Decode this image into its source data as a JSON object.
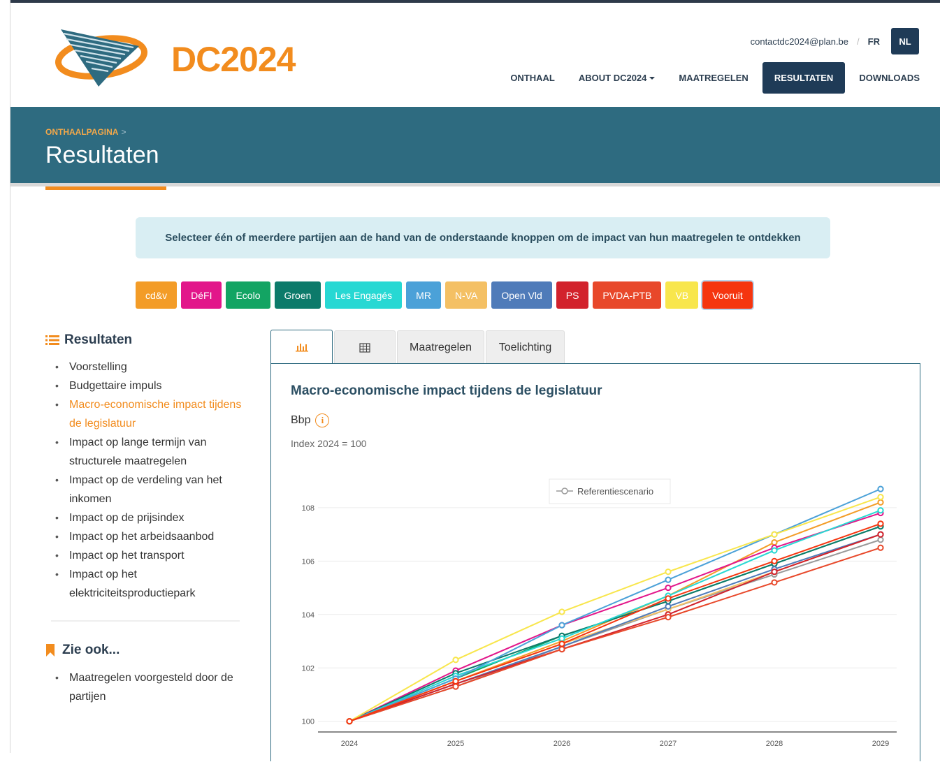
{
  "header": {
    "logo_text": "DC2024",
    "contact": "contactdc2024@plan.be",
    "lang_separator": "/",
    "lang_fr": "FR",
    "lang_nl": "NL",
    "nav": [
      {
        "label": "ONTHAAL"
      },
      {
        "label": "ABOUT DC2024"
      },
      {
        "label": "MAATREGELEN"
      },
      {
        "label": "RESULTATEN"
      },
      {
        "label": "DOWNLOADS"
      }
    ]
  },
  "banner": {
    "breadcrumb": "ONTHAALPAGINA",
    "breadcrumb_sep": ">",
    "title": "Resultaten"
  },
  "info_text": "Selecteer één of meerdere partijen aan de hand van de onderstaande knoppen om de impact van hun maatregelen te ontdekken",
  "parties": [
    {
      "label": "cd&v",
      "color": "#f39c27"
    },
    {
      "label": "DéFI",
      "color": "#e2168a"
    },
    {
      "label": "Ecolo",
      "color": "#13a463"
    },
    {
      "label": "Groen",
      "color": "#0c7a6a"
    },
    {
      "label": "Les Engagés",
      "color": "#27d8d3"
    },
    {
      "label": "MR",
      "color": "#4ba1d8"
    },
    {
      "label": "N-VA",
      "color": "#f4c064"
    },
    {
      "label": "Open Vld",
      "color": "#4f7bb9"
    },
    {
      "label": "PS",
      "color": "#d2222c"
    },
    {
      "label": "PVDA-PTB",
      "color": "#e8482a"
    },
    {
      "label": "VB",
      "color": "#f8e64c"
    },
    {
      "label": "Vooruit",
      "color": "#f5350f"
    }
  ],
  "sidebar": {
    "title": "Resultaten",
    "items": [
      {
        "label": "Voorstelling"
      },
      {
        "label": "Budgettaire impuls"
      },
      {
        "label": "Macro-economische impact tijdens de legislatuur"
      },
      {
        "label": "Impact op lange termijn van structurele maatregelen"
      },
      {
        "label": "Impact op de verdeling van het inkomen"
      },
      {
        "label": "Impact op de prijsindex"
      },
      {
        "label": "Impact op het arbeidsaanbod"
      },
      {
        "label": "Impact op het transport"
      },
      {
        "label": "Impact op het elektriciteitsproductiepark"
      }
    ],
    "active_index": 2,
    "see_also_title": "Zie ook...",
    "see_also_items": [
      {
        "label": "Maatregelen voorgesteld door de partijen"
      }
    ]
  },
  "tabs": {
    "chart_icon": "bar-chart-icon",
    "table_icon": "table-icon",
    "maatregelen": "Maatregelen",
    "toelichting": "Toelichting"
  },
  "panel": {
    "title": "Macro-economische impact tijdens de legislatuur",
    "variable": "Bbp",
    "info_glyph": "i",
    "subtitle": "Index 2024 = 100"
  },
  "chart_data": {
    "type": "line",
    "x": [
      "2024",
      "2025",
      "2026",
      "2027",
      "2028",
      "2029"
    ],
    "ylim": [
      99.6,
      109.2
    ],
    "yticks": [
      100,
      102,
      104,
      106,
      108
    ],
    "legend": "Referentiescenario",
    "legend_position": "top-center",
    "grid": true,
    "series": [
      {
        "color": "#999999",
        "values": [
          100,
          101.3,
          102.8,
          104.2,
          105.5,
          106.8
        ]
      },
      {
        "color": "#f39c27",
        "values": [
          100,
          101.5,
          103.0,
          104.7,
          106.7,
          108.2
        ]
      },
      {
        "color": "#e2168a",
        "values": [
          100,
          101.9,
          103.6,
          105.0,
          106.5,
          107.8
        ]
      },
      {
        "color": "#13a463",
        "values": [
          100,
          101.6,
          103.2,
          104.5,
          105.9,
          107.3
        ]
      },
      {
        "color": "#0c7a6a",
        "values": [
          100,
          101.8,
          103.2,
          104.5,
          105.9,
          107.3
        ]
      },
      {
        "color": "#27d8d3",
        "values": [
          100,
          101.7,
          103.1,
          104.7,
          106.4,
          107.9
        ]
      },
      {
        "color": "#4ba1d8",
        "values": [
          100,
          101.6,
          103.6,
          105.3,
          107.0,
          108.7
        ]
      },
      {
        "color": "#f4c064",
        "values": [
          100,
          101.5,
          102.9,
          104.2,
          105.6,
          107.0
        ]
      },
      {
        "color": "#4f7bb9",
        "values": [
          100,
          101.4,
          102.8,
          104.3,
          105.7,
          107.0
        ]
      },
      {
        "color": "#d2222c",
        "values": [
          100,
          101.4,
          102.7,
          104.0,
          105.6,
          107.0
        ]
      },
      {
        "color": "#e8482a",
        "values": [
          100,
          101.3,
          102.7,
          103.9,
          105.2,
          106.5
        ]
      },
      {
        "color": "#f8e64c",
        "values": [
          100,
          102.3,
          104.1,
          105.6,
          107.0,
          108.4
        ]
      },
      {
        "color": "#f5350f",
        "values": [
          100,
          101.5,
          102.9,
          104.6,
          106.0,
          107.4
        ]
      }
    ]
  }
}
